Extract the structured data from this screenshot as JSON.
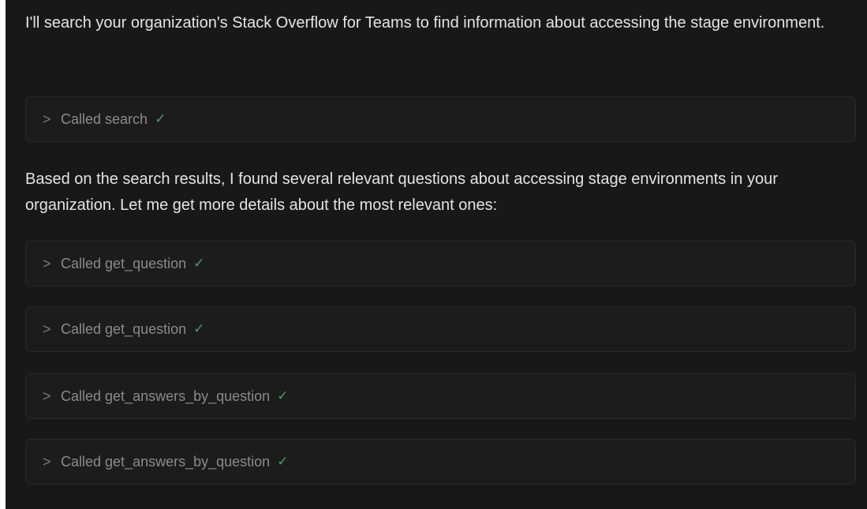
{
  "messages": {
    "intro": "I'll search your organization's Stack Overflow for Teams to find information about accessing the stage environment.",
    "followup": "Based on the search results, I found several relevant questions about accessing stage environments in your organization. Let me get more details about the most relevant ones:"
  },
  "tool_calls": [
    {
      "label": "Called search",
      "status_icon": "checkmark-icon"
    },
    {
      "label": "Called get_question",
      "status_icon": "checkmark-icon"
    },
    {
      "label": "Called get_question",
      "status_icon": "checkmark-icon"
    },
    {
      "label": "Called get_answers_by_question",
      "status_icon": "checkmark-icon"
    },
    {
      "label": "Called get_answers_by_question",
      "status_icon": "checkmark-icon"
    }
  ],
  "colors": {
    "background": "#181818",
    "text": "#e4e4e4",
    "muted": "#8a8a8a",
    "success": "#4f9a62"
  }
}
